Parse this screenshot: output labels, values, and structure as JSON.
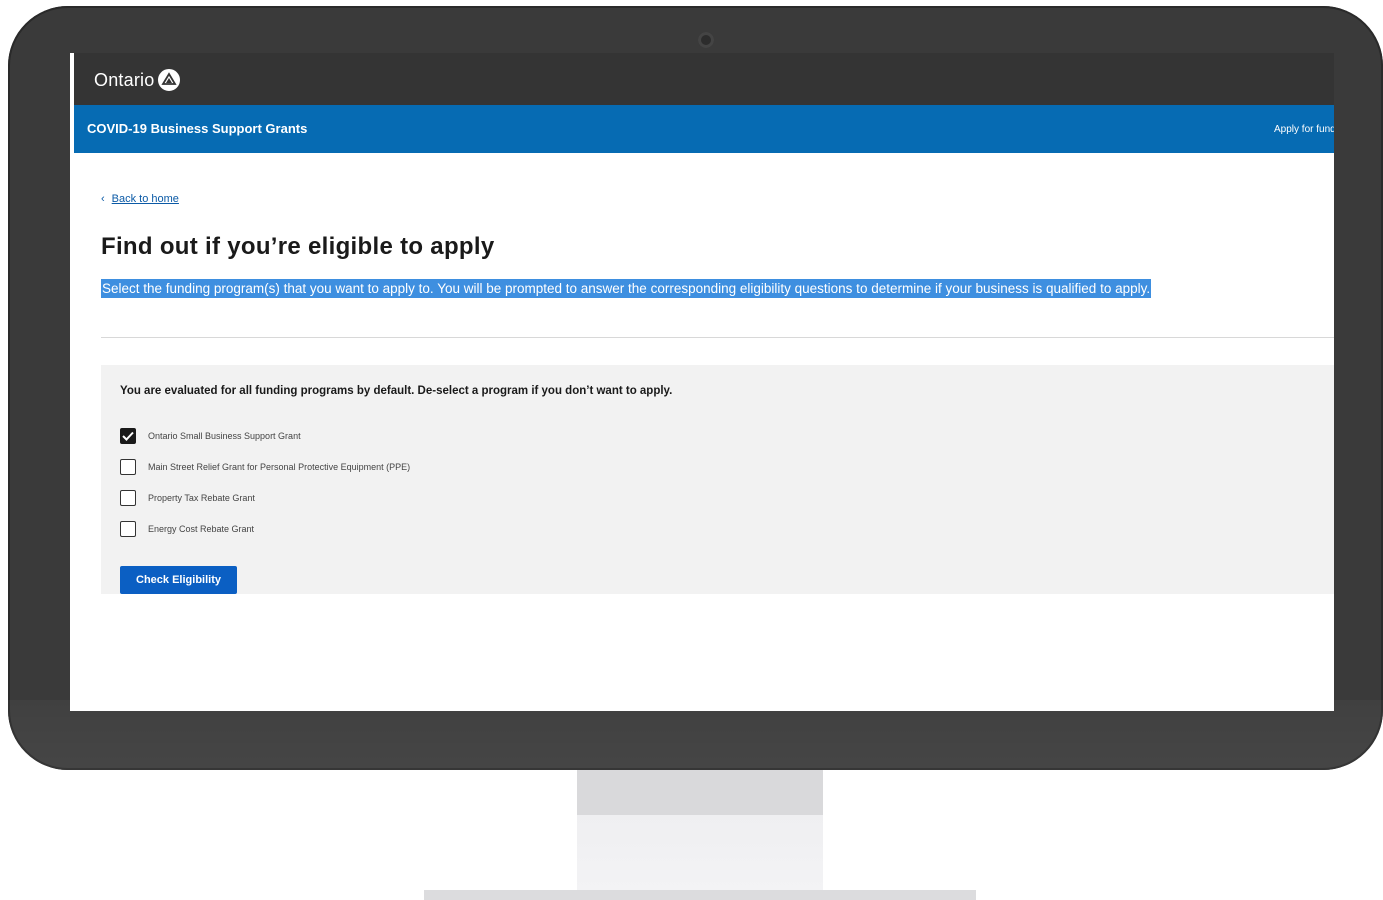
{
  "header": {
    "brand": "Ontario",
    "logo_icon": "trillium-icon"
  },
  "subheader": {
    "title": "COVID-19 Business Support Grants",
    "link": "Apply for funding"
  },
  "back": {
    "chevron": "‹",
    "label": "Back to home"
  },
  "page": {
    "title": "Find out if you’re eligible to apply",
    "intro": "Select the funding program(s) that you want to apply to. You will be prompted to answer the corresponding eligibility questions to determine if your business is qualified to apply."
  },
  "panel": {
    "note": "You are evaluated for all funding programs by default. De-select a program if you don’t want to apply.",
    "options": [
      {
        "label": "Ontario Small Business Support Grant",
        "checked": true
      },
      {
        "label": "Main Street Relief Grant for Personal Protective Equipment (PPE)",
        "checked": false
      },
      {
        "label": "Property Tax Rebate Grant",
        "checked": false
      },
      {
        "label": "Energy Cost Rebate Grant",
        "checked": false
      }
    ],
    "button": "Check Eligibility"
  },
  "colors": {
    "topbar": "#343434",
    "brand_blue": "#066bb3",
    "button_blue": "#0b5fc3",
    "selection_highlight": "#3e8fe0"
  }
}
